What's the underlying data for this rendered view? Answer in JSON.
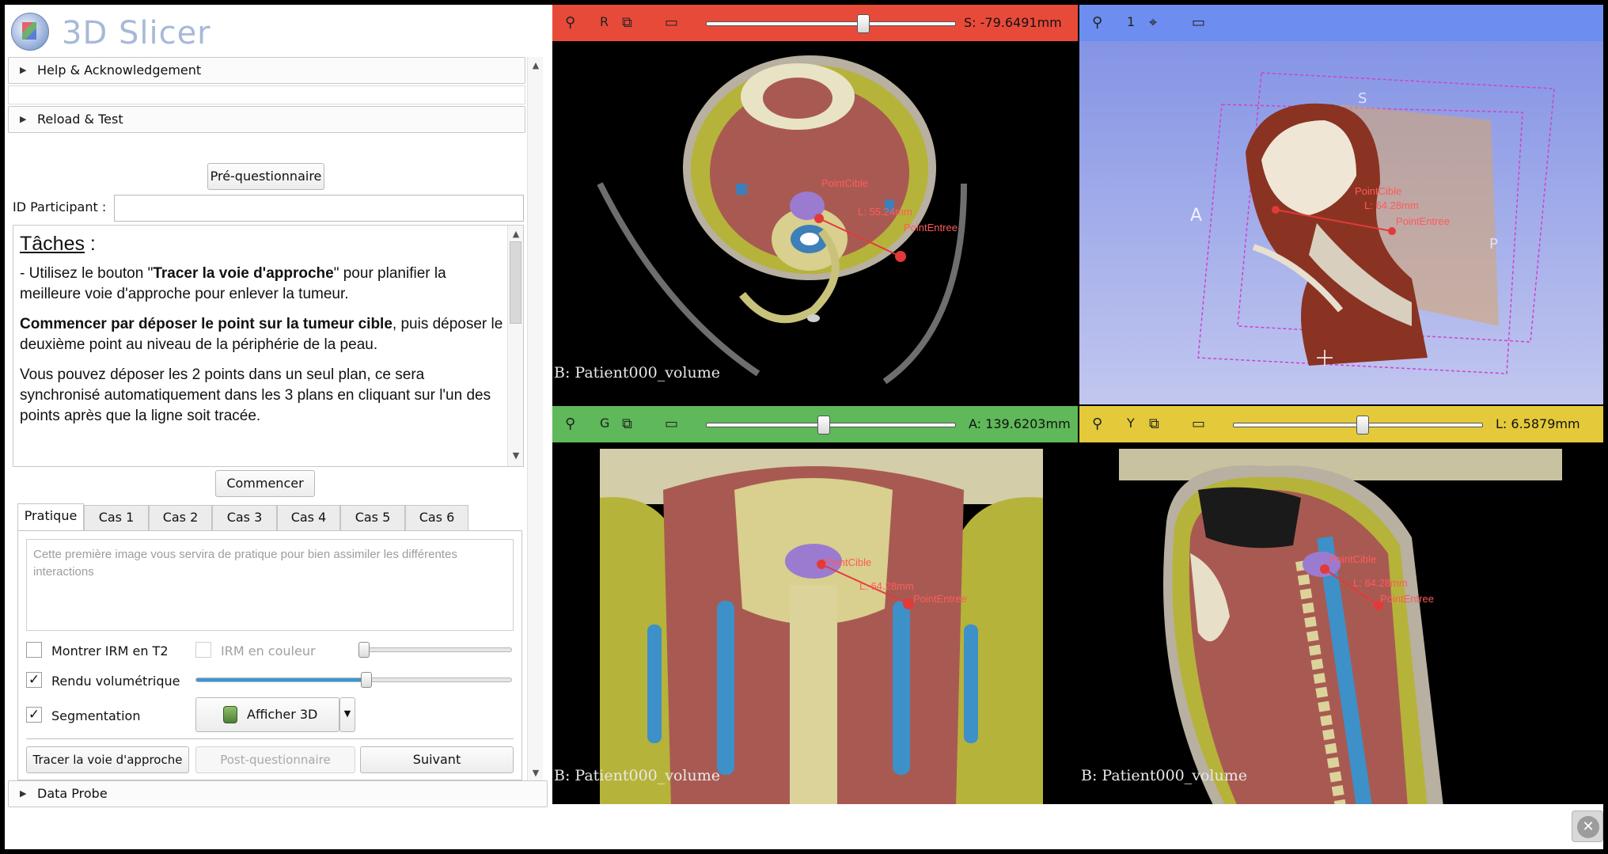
{
  "app": {
    "title": "3D Slicer"
  },
  "sections": {
    "help": "Help & Acknowledgement",
    "reload": "Reload & Test",
    "data_probe": "Data Probe"
  },
  "form": {
    "pre_questionnaire": "Pré-questionnaire",
    "participant_label": "ID Participant :",
    "participant_value": "",
    "start_button": "Commencer"
  },
  "tasks": {
    "heading": "Tâches",
    "heading_suffix": " :",
    "p1_pre": "- Utilisez le bouton \"",
    "p1_bold": "Tracer la voie d'approche",
    "p1_post": "\" pour planifier la meilleure voie d'approche pour enlever la tumeur.",
    "p2_bold": "Commencer par déposer le point sur la tumeur cible",
    "p2_post": ", puis déposer le deuxième point au niveau de la périphérie de la peau.",
    "p3": "Vous pouvez déposer les 2 points dans un seul plan, ce sera synchronisé automatiquement dans les 3 plans en cliquant sur l'un des points après que la ligne soit tracée."
  },
  "tabs": [
    "Pratique",
    "Cas 1",
    "Cas 2",
    "Cas 3",
    "Cas 4",
    "Cas 5",
    "Cas 6"
  ],
  "practice": {
    "description": "Cette première image vous servira de pratique pour bien assimiler les différentes interactions",
    "show_mri_t2": "Montrer IRM en T2",
    "show_mri_t2_checked": false,
    "mri_color": "IRM en couleur",
    "mri_color_checked": false,
    "mri_color_level": 0.0,
    "volume_render": "Rendu volumétrique",
    "volume_render_checked": true,
    "volume_render_level": 0.54,
    "segmentation": "Segmentation",
    "segmentation_checked": true,
    "show3d": "Afficher 3D",
    "trace_button": "Tracer la voie d'approche",
    "post_questionnaire": "Post-questionnaire",
    "next_button": "Suivant"
  },
  "views": {
    "red": {
      "letter": "R",
      "offset": "S: -79.6491mm",
      "level": 0.63,
      "color": "#e84a3a",
      "label": "B: Patient000_volume"
    },
    "threed": {
      "letter": "1",
      "color": "#6d8ef0"
    },
    "green": {
      "letter": "G",
      "offset": "A: 139.6203mm",
      "level": 0.47,
      "color": "#5fb85a",
      "label": "B: Patient000_volume"
    },
    "yellow": {
      "letter": "Y",
      "offset": "L: 6.5879mm",
      "level": 0.52,
      "color": "#e4ca3a",
      "label": "B: Patient000_volume"
    }
  },
  "annotations": {
    "target": "PointCible",
    "entry": "PointEntree",
    "length_axial": "L: 55.24mm",
    "length_coronal": "L: 64.28mm",
    "length_sagittal": "L: 64.28mm",
    "length_3d": "L: 64.28mm",
    "orient_a": "A",
    "orient_s": "S",
    "orient_p": "P"
  }
}
